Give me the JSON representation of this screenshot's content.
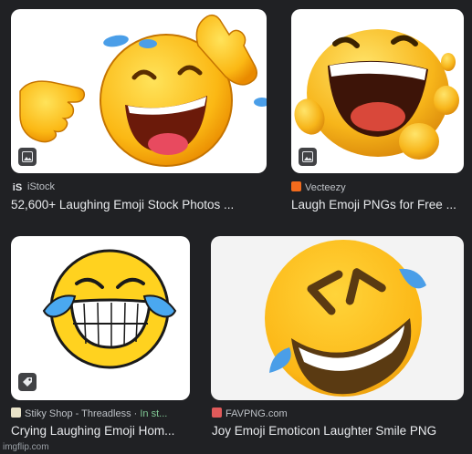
{
  "results": [
    {
      "source": "iStock",
      "source_logo": "iS",
      "title": "52,600+ Laughing Emoji Stock Photos ...",
      "badge_icon": "image-icon"
    },
    {
      "source": "Vecteezy",
      "title": "Laugh Emoji PNGs for Free ...",
      "badge_icon": "image-icon"
    },
    {
      "source": "Stiky Shop - Threadless",
      "stock_status": "In st...",
      "title": "Crying Laughing Emoji Hom...",
      "badge_icon": "tag-icon"
    },
    {
      "source": "FAVPNG.com",
      "title": "Joy Emoji Emoticon Laughter Smile PNG"
    }
  ],
  "watermark": "imgflip.com",
  "colors": {
    "background": "#202124",
    "title_text": "#e8eaed",
    "source_text": "#bdc1c6",
    "in_stock": "#81c995",
    "emoji_yellow": "#ffcc22",
    "tear_blue": "#4a9ee8"
  }
}
